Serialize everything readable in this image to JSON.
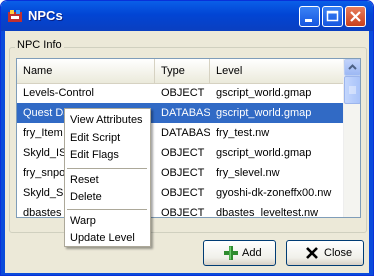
{
  "window": {
    "title": "NPCs"
  },
  "group": {
    "label": "NPC Info"
  },
  "table": {
    "columns": [
      "Name",
      "Type",
      "Level"
    ],
    "rows": [
      {
        "name": "Levels-Control",
        "type": "OBJECT",
        "level": "gscript_world.gmap"
      },
      {
        "name": "Quest Da",
        "type": "DATABASE",
        "level": "gscript_world.gmap"
      },
      {
        "name": "fry_Item",
        "type": "DATABASE",
        "level": "fry_test.nw"
      },
      {
        "name": "Skyld_IS",
        "type": "OBJECT",
        "level": "gscript_world.gmap"
      },
      {
        "name": "fry_snpo",
        "type": "OBJECT",
        "level": "fry_slevel.nw"
      },
      {
        "name": "Skyld_Sh",
        "type": "OBJECT",
        "level": "gyoshi-dk-zoneffx00.nw"
      },
      {
        "name": "dbastes",
        "type": "OBJECT",
        "level": "dbastes_leveltest.nw"
      }
    ],
    "selected_row": 1
  },
  "context_menu": {
    "groups": [
      [
        "View Attributes",
        "Edit Script",
        "Edit Flags"
      ],
      [
        "Reset",
        "Delete"
      ],
      [
        "Warp",
        "Update Level"
      ]
    ]
  },
  "buttons": {
    "add": "Add",
    "close": "Close"
  },
  "colors": {
    "selection": "#316AC5",
    "titlebar": "#0245D4",
    "window_bg": "#ECE9D8"
  }
}
